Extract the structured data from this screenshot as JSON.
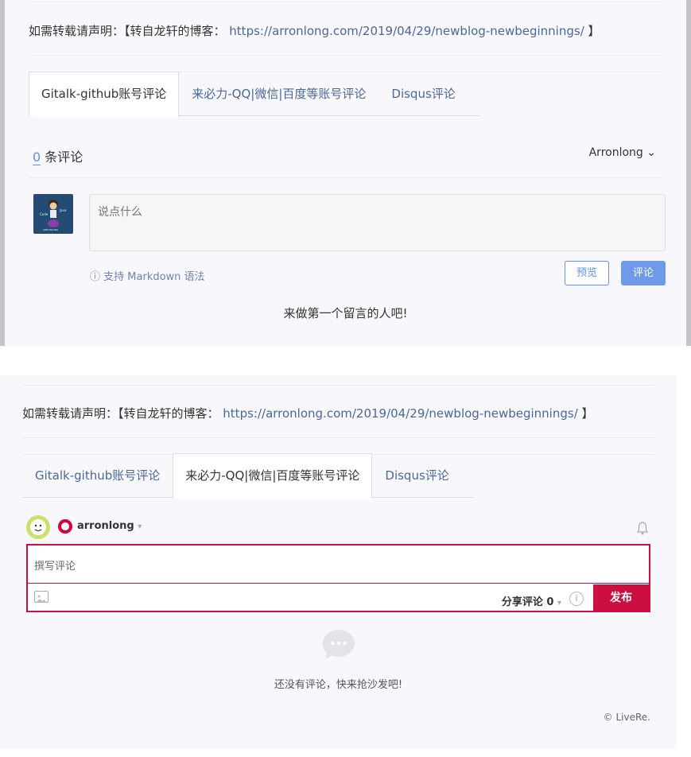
{
  "gitalk_panel": {
    "repost_prefix": "如需转载请声明：【转自龙轩的博客：",
    "repost_url": "https://arronlong.com/2019/04/29/newblog-newbeginnings/",
    "repost_suffix": "】",
    "tabs": [
      {
        "label": "Gitalk-github账号评论",
        "active": true
      },
      {
        "label": "来必力-QQ|微信|百度等账号评论",
        "active": false
      },
      {
        "label": "Disqus评论",
        "active": false
      }
    ],
    "comment_count": "0",
    "comment_count_label": "条评论",
    "user_menu": "Arronlong",
    "user_menu_caret": "⌄",
    "editor_placeholder": "说点什么",
    "markdown_tip": "支持 Markdown 语法",
    "markdown_tip_icon": "ⓘ",
    "preview_button": "预览",
    "comment_button": "评论",
    "empty_message": "来做第一个留言的人吧!"
  },
  "livere_panel": {
    "repost_prefix": "如需转载请声明：【转自龙轩的博客：",
    "repost_url": "https://arronlong.com/2019/04/29/newblog-newbeginnings/",
    "repost_suffix": "】",
    "tabs": [
      {
        "label": "Gitalk-github账号评论",
        "active": false
      },
      {
        "label": "来必力-QQ|微信|百度等账号评论",
        "active": true
      },
      {
        "label": "Disqus评论",
        "active": false
      }
    ],
    "username": "arronlong",
    "username_caret": "▾",
    "input_placeholder": "撰写评论",
    "share_label": "分享评论 0",
    "share_caret": "▾",
    "info_icon": "i",
    "post_button": "发布",
    "empty_message": "还没有评论，快来抢沙发吧!",
    "brand": "© LiveRe."
  },
  "colors": {
    "link": "#4a6796",
    "gitalk_accent": "#6190e8",
    "livere_accent": "#cc0f40",
    "panel_bg": "#f8f8fc"
  }
}
